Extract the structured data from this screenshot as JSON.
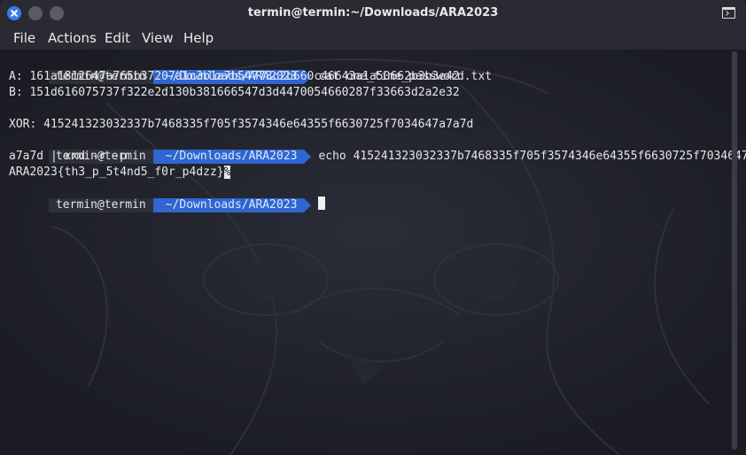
{
  "window": {
    "title": "termin@termin:~/Downloads/ARA2023"
  },
  "menu": {
    "items": [
      "File",
      "Actions",
      "Edit",
      "View",
      "Help"
    ]
  },
  "terminal": {
    "prompt_user": "termin@termin",
    "prompt_path": "~/Downloads/ARA2023",
    "commands": [
      "cat one_time_password.txt",
      "echo 415241323032337b7468335f705f3574346e64355f6630725f7034647",
      ""
    ],
    "output_lines": [
      "A: 161a1812647a765b37207a1c3b1a7b54773c2b660c46643a1a50662b3b3e42",
      "B: 151d616075737f322e2d130b381666547d3d4470054660287f33663d2a2e32",
      "",
      "XOR: 415241323032337b7468335f705f3574346e64355f6630725f7034647a7a7d"
    ],
    "wrap_line": "a7a7d | xxd -r -p",
    "flag_text": "ARA2023{th3_p_5t4nd5_f0r_p4dzz}",
    "flag_marker": "%"
  }
}
